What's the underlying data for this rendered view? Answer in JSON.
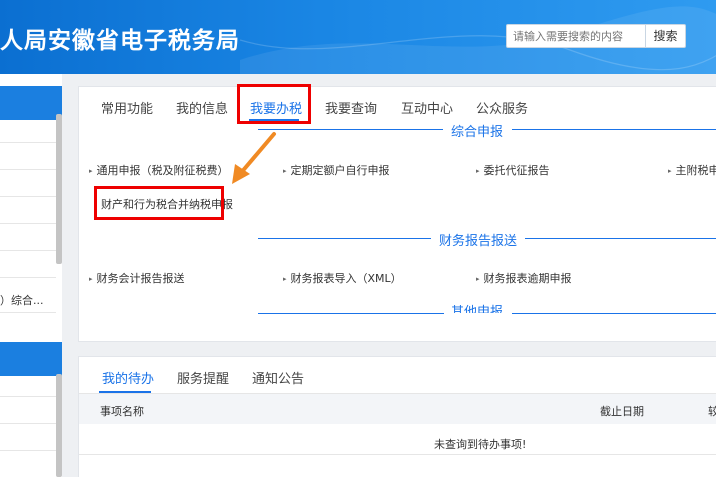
{
  "header": {
    "title": "人局安徽省电子税务局",
    "search_placeholder": "请输入需要搜索的内容",
    "search_button": "搜索"
  },
  "sidebar": {
    "truncated_item": "）综合..."
  },
  "nav": {
    "tabs": [
      {
        "label": "常用功能"
      },
      {
        "label": "我的信息"
      },
      {
        "label": "我要办税"
      },
      {
        "label": "我要查询"
      },
      {
        "label": "互动中心"
      },
      {
        "label": "公众服务"
      }
    ],
    "active_tab": "我要办税"
  },
  "sections": [
    {
      "title": "综合申报",
      "items": [
        {
          "label": "通用申报（税及附征税费）"
        },
        {
          "label": "定期定额户自行申报"
        },
        {
          "label": "委托代征报告"
        },
        {
          "label": "主附税申"
        },
        {
          "label": "财产和行为税合并纳税申报"
        }
      ]
    },
    {
      "title": "财务报告报送",
      "items": [
        {
          "label": "财务会计报告报送"
        },
        {
          "label": "财务报表导入（XML）"
        },
        {
          "label": "财务报表逾期申报"
        }
      ]
    },
    {
      "title": "其他申报",
      "items": []
    }
  ],
  "todo": {
    "tabs": [
      {
        "label": "我的待办"
      },
      {
        "label": "服务提醒"
      },
      {
        "label": "通知公告"
      }
    ],
    "columns": {
      "name": "事项名称",
      "deadline": "截止日期",
      "extra": "较"
    },
    "empty_message": "未查询到待办事项!"
  },
  "colors": {
    "header_blue": "#1a86e4",
    "accent": "#1a73e8",
    "highlight_red": "#e00000",
    "arrow_orange": "#f08a24"
  }
}
